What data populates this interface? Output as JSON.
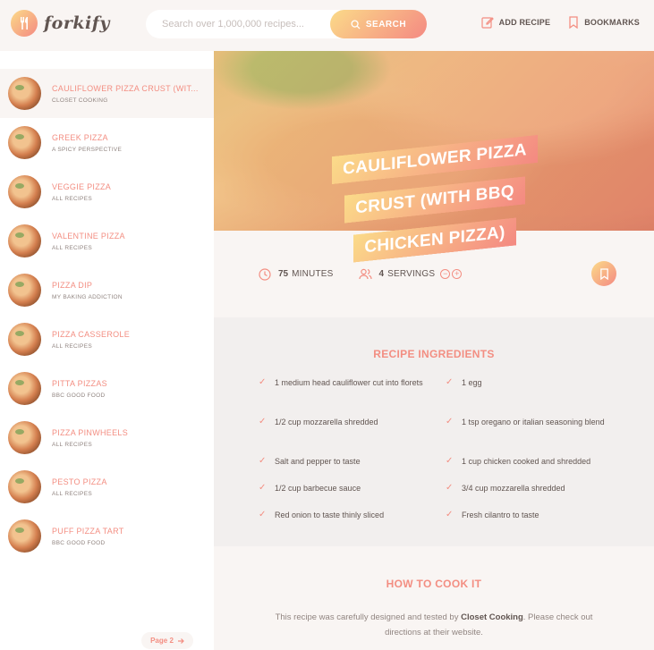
{
  "app": {
    "logo_text": "forkify",
    "brand_gradient": [
      "#fbdb89",
      "#f48982"
    ],
    "accent": "#f38e82"
  },
  "search": {
    "placeholder": "Search over 1,000,000 recipes...",
    "button_label": "SEARCH",
    "icon": "search-icon"
  },
  "nav": {
    "add_recipe": "ADD RECIPE",
    "bookmarks": "BOOKMARKS"
  },
  "results": [
    {
      "title": "CAULIFLOWER PIZZA CRUST (WIT...",
      "publisher": "CLOSET COOKING",
      "active": true
    },
    {
      "title": "GREEK PIZZA",
      "publisher": "A SPICY PERSPECTIVE"
    },
    {
      "title": "VEGGIE PIZZA",
      "publisher": "ALL RECIPES"
    },
    {
      "title": "VALENTINE PIZZA",
      "publisher": "ALL RECIPES"
    },
    {
      "title": "PIZZA DIP",
      "publisher": "MY BAKING ADDICTION"
    },
    {
      "title": "PIZZA CASSEROLE",
      "publisher": "ALL RECIPES"
    },
    {
      "title": "PITTA PIZZAS",
      "publisher": "BBC GOOD FOOD"
    },
    {
      "title": "PIZZA PINWHEELS",
      "publisher": "ALL RECIPES"
    },
    {
      "title": "PESTO PIZZA",
      "publisher": "ALL RECIPES"
    },
    {
      "title": "PUFF PIZZA TART",
      "publisher": "BBC GOOD FOOD"
    }
  ],
  "pagination": {
    "next_label": "Page 2"
  },
  "recipe": {
    "title": "CAULIFLOWER PIZZA CRUST (WITH BBQ CHICKEN PIZZA)",
    "minutes": "75",
    "minutes_label": "MINUTES",
    "servings": "4",
    "servings_label": "SERVINGS",
    "ingredients_heading": "RECIPE INGREDIENTS",
    "ingredients": [
      "1 medium head cauliflower cut into florets",
      "1 egg",
      "1/2 cup mozzarella shredded",
      "1 tsp oregano or italian seasoning blend",
      "Salt and pepper to taste",
      "1 cup chicken cooked and shredded",
      "1/2 cup barbecue sauce",
      "3/4 cup mozzarella shredded",
      "Red onion to taste thinly sliced",
      "Fresh cilantro to taste"
    ],
    "directions_heading": "HOW TO COOK IT",
    "directions_pre": "This recipe was carefully designed and tested by",
    "publisher": "Closet Cooking",
    "directions_post": ". Please check out directions at their website."
  }
}
